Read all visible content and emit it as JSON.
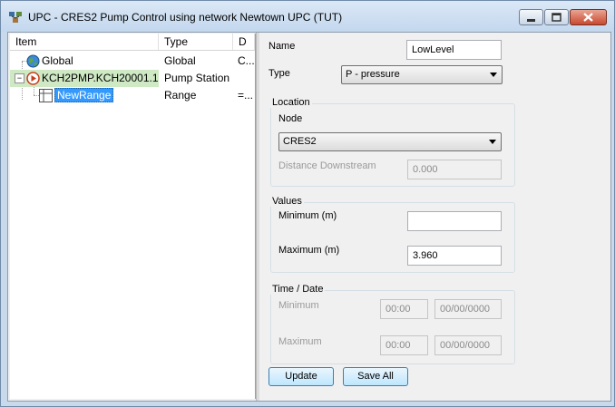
{
  "window": {
    "title": "UPC - CRES2 Pump Control  using network Newtown UPC (TUT)",
    "icons": {
      "app": "pump-control-app-icon",
      "minimize": "minimize-icon",
      "maximize": "maximize-icon",
      "close": "close-icon"
    }
  },
  "tree": {
    "columns": [
      "Item",
      "Type",
      "D"
    ],
    "rows": [
      {
        "item": "Global",
        "type": "Global",
        "d": "C...",
        "icon": "globe-icon"
      },
      {
        "item": "KCH2PMP.KCH20001.1",
        "type": "Pump Station",
        "d": "",
        "icon": "pump-station-icon",
        "expander": "−"
      },
      {
        "item": "NewRange",
        "type": "Range",
        "d": "=...",
        "icon": "range-grid-icon"
      }
    ]
  },
  "form": {
    "name_label": "Name",
    "name_value": "LowLevel",
    "type_label": "Type",
    "type_value": "P - pressure",
    "location": {
      "title": "Location",
      "node_label": "Node",
      "node_value": "CRES2",
      "distance_label": "Distance Downstream",
      "distance_value": "0.000"
    },
    "values": {
      "title": "Values",
      "minimum_label": "Minimum (m)",
      "minimum_value": "",
      "maximum_label": "Maximum (m)",
      "maximum_value": "3.960"
    },
    "time": {
      "title": "Time / Date",
      "minimum_label": "Minimum",
      "min_time": "00:00",
      "min_date": "00/00/0000",
      "maximum_label": "Maximum",
      "max_time": "00:00",
      "max_date": "00/00/0000"
    },
    "update_button": "Update",
    "save_all_button": "Save All"
  }
}
